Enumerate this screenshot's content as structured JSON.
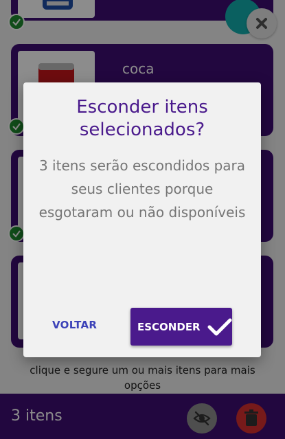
{
  "items": [
    {
      "name": "",
      "thumb_icon": "soda-can-blue"
    },
    {
      "name": "coca",
      "thumb_icon": "soda-can-red"
    },
    {
      "name": "",
      "thumb_icon": "empty-thumbnail"
    },
    {
      "name": "",
      "thumb_icon": "empty-thumbnail"
    }
  ],
  "hint_text": "clique e segure um ou mais itens para mais opções",
  "bottom_bar": {
    "count": "3 itens"
  },
  "dialog": {
    "title": "Esconder itens selecionados?",
    "body": "3 itens serão escondidos para seus clientes porque esgotaram ou não disponíveis",
    "back_label": "VOLTAR",
    "confirm_label": "ESCONDER"
  },
  "colors": {
    "primary": "#4a1a8c",
    "card": "#3f0d74",
    "success": "#1e8a2e",
    "danger": "#d93030",
    "link": "#3c42b8"
  }
}
